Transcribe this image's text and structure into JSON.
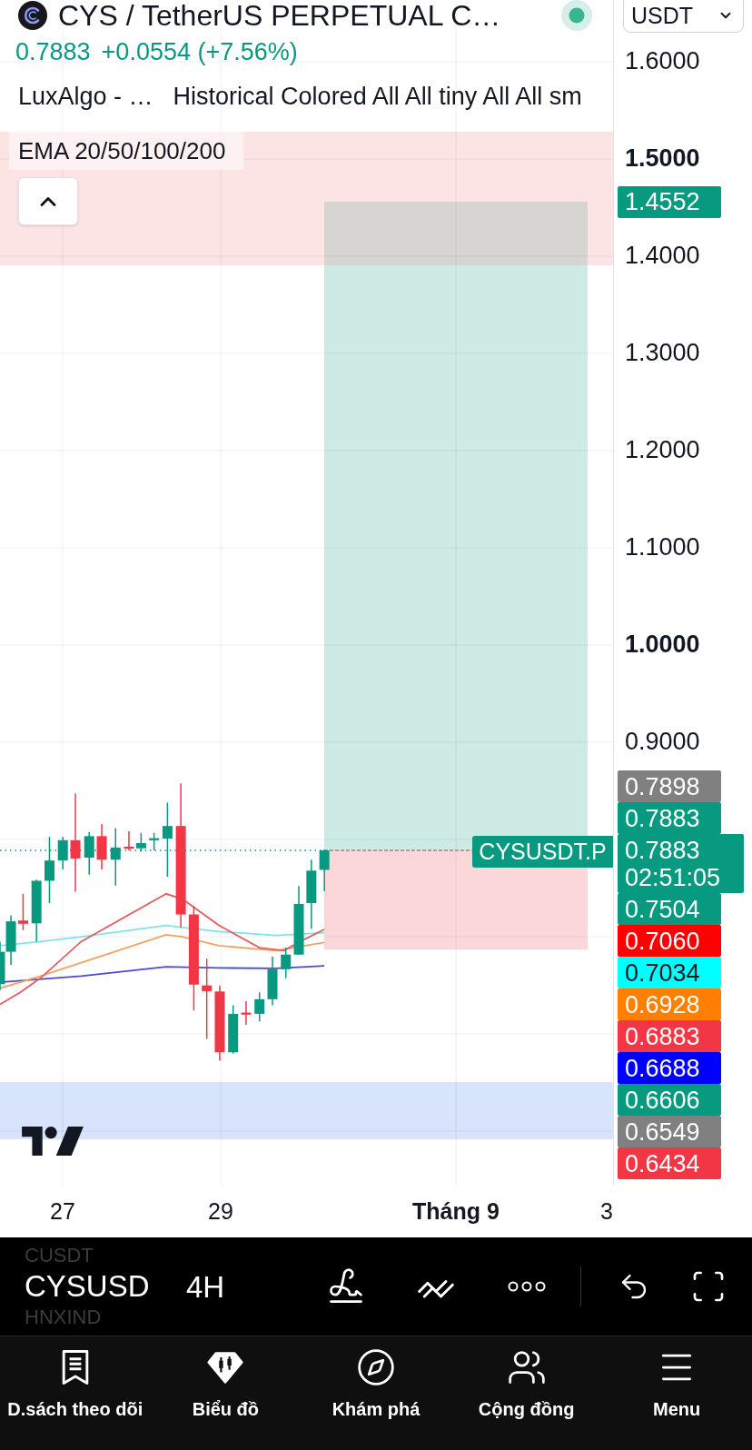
{
  "header": {
    "title": "CYS / TetherUS PERPETUAL C…",
    "currency": "USDT"
  },
  "quote": {
    "last": "0.7883",
    "change": "+0.0554 (+7.56%)"
  },
  "indicators": [
    {
      "label": "LuxAlgo - …"
    },
    {
      "label": "Historical Colored All All tiny All All sm"
    }
  ],
  "ema_legend": "EMA 20/50/100/200",
  "chart": {
    "symbol_tag": "CYSUSDT.P"
  },
  "price_axis": {
    "ticks": [
      {
        "label": "1.6000",
        "major": false
      },
      {
        "label": "1.5000",
        "major": true
      },
      {
        "label": "1.4000",
        "major": false
      },
      {
        "label": "1.3000",
        "major": false
      },
      {
        "label": "1.2000",
        "major": false
      },
      {
        "label": "1.1000",
        "major": false
      },
      {
        "label": "1.0000",
        "major": true
      },
      {
        "label": "0.9000",
        "major": false
      }
    ],
    "target_badge": "1.4552",
    "badges": [
      {
        "text": "0.7898",
        "color": "#808080"
      },
      {
        "text": "0.7883",
        "color": "#089981"
      },
      {
        "text": "0.7883",
        "countdown": "02:51:05",
        "color": "#089981"
      },
      {
        "text": "0.7504",
        "color": "#089981"
      },
      {
        "text": "0.7060",
        "color": "#ff0000"
      },
      {
        "text": "0.7034",
        "color": "#00ffff"
      },
      {
        "text": "0.6928",
        "color": "#ff7f00"
      },
      {
        "text": "0.6883",
        "color": "#f23645"
      },
      {
        "text": "0.6688",
        "color": "#0000ff"
      },
      {
        "text": "0.6606",
        "color": "#089981"
      },
      {
        "text": "0.6549",
        "color": "#808080"
      },
      {
        "text": "0.6434",
        "color": "#f23645"
      }
    ]
  },
  "time_axis": [
    {
      "label": "27",
      "major": false
    },
    {
      "label": "29",
      "major": false
    },
    {
      "label": "Tháng 9",
      "major": true
    },
    {
      "label": "3",
      "major": false
    }
  ],
  "toolbar": {
    "symbols": [
      {
        "label": "CUSDT",
        "selected": false
      },
      {
        "label": "CYSUSD",
        "selected": true
      },
      {
        "label": "HNXIND",
        "selected": false
      }
    ],
    "interval": "4H"
  },
  "nav": [
    {
      "label": "D.sách theo dõi"
    },
    {
      "label": "Biểu đồ"
    },
    {
      "label": "Khám phá"
    },
    {
      "label": "Cộng đồng"
    },
    {
      "label": "Menu"
    }
  ]
}
